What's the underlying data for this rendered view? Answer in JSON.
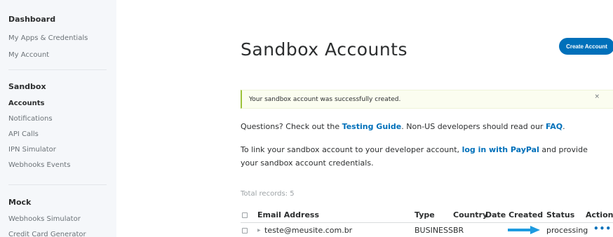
{
  "sidebar": {
    "dashboard": {
      "heading": "Dashboard",
      "items": [
        {
          "label": "My Apps & Credentials"
        },
        {
          "label": "My Account"
        }
      ]
    },
    "sandbox": {
      "heading": "Sandbox",
      "items": [
        {
          "label": "Accounts",
          "active": true
        },
        {
          "label": "Notifications"
        },
        {
          "label": "API Calls"
        },
        {
          "label": "IPN Simulator"
        },
        {
          "label": "Webhooks Events"
        }
      ]
    },
    "mock": {
      "heading": "Mock",
      "items": [
        {
          "label": "Webhooks Simulator"
        },
        {
          "label": "Credit Card Generator"
        }
      ]
    }
  },
  "main": {
    "title": "Sandbox Accounts",
    "create_button": "Create Account",
    "alert": {
      "message": "Your sandbox account was successfully created.",
      "close": "×"
    },
    "help": {
      "prefix": "Questions? Check out the ",
      "testing_guide": "Testing Guide",
      "middle": ". Non-US developers should read our ",
      "faq": "FAQ",
      "suffix": "."
    },
    "link_info": {
      "prefix": "To link your sandbox account to your developer account, ",
      "link": "log in with PayPal",
      "suffix": " and provide your sandbox account credentials."
    },
    "total_records": "Total records: 5",
    "table": {
      "headers": {
        "email": "Email Address",
        "type": "Type",
        "country": "Country",
        "date_created": "Date Created",
        "status": "Status",
        "actions": "Actions"
      },
      "rows": [
        {
          "email": "teste@meusite.com.br",
          "type": "BUSINESS",
          "country": "BR",
          "date_created": "",
          "status": "processing",
          "actions": "•••"
        }
      ]
    },
    "colors": {
      "accent": "#0070ba",
      "arrow": "#1e9be0",
      "alert_border": "#9cc23a"
    },
    "icons": [
      "caret-right-icon",
      "arrow-right-icon",
      "more-horizontal-icon",
      "close-icon"
    ]
  }
}
